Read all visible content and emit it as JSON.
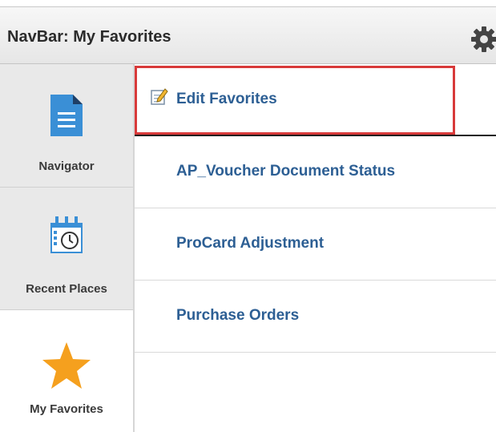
{
  "header": {
    "title": "NavBar: My Favorites",
    "gear_icon": "gear-icon"
  },
  "sidebar": {
    "items": [
      {
        "label": "Navigator",
        "icon": "document-icon",
        "active": false
      },
      {
        "label": "Recent Places",
        "icon": "calendar-clock-icon",
        "active": false
      },
      {
        "label": "My Favorites",
        "icon": "star-icon",
        "active": true
      }
    ]
  },
  "favorites": {
    "edit_label": "Edit Favorites",
    "edit_icon": "edit-pencil-icon",
    "items": [
      {
        "label": "AP_Voucher Document Status"
      },
      {
        "label": "ProCard Adjustment"
      },
      {
        "label": "Purchase Orders"
      }
    ]
  },
  "colors": {
    "link": "#2d5f94",
    "highlight": "#d83a3a",
    "icon_blue": "#3a8fd6",
    "star": "#f5a01e"
  }
}
